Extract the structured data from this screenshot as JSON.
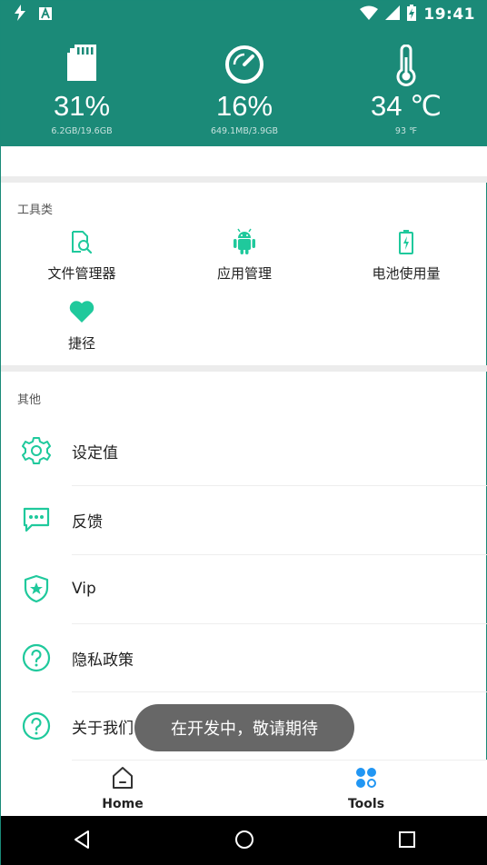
{
  "status_bar": {
    "time": "19:41",
    "left_icons": [
      "flash-icon",
      "font-a-icon"
    ],
    "right_icons": [
      "wifi-icon",
      "cell-signal-icon",
      "battery-charging-icon"
    ]
  },
  "stats": [
    {
      "icon": "sd-card-icon",
      "value": "31%",
      "sub": "6.2GB/19.6GB"
    },
    {
      "icon": "speedometer-icon",
      "value": "16%",
      "sub": "649.1MB/3.9GB"
    },
    {
      "icon": "thermometer-icon",
      "value": "34 ℃",
      "sub": "93 ℉"
    }
  ],
  "tools_section": {
    "label": "工具类",
    "items": [
      {
        "icon": "file-search-icon",
        "label": "文件管理器"
      },
      {
        "icon": "android-icon",
        "label": "应用管理"
      },
      {
        "icon": "battery-icon",
        "label": "电池使用量"
      },
      {
        "icon": "heart-icon",
        "label": "捷径"
      }
    ]
  },
  "other_section": {
    "label": "其他",
    "items": [
      {
        "icon": "gear-icon",
        "label": "设定值"
      },
      {
        "icon": "chat-bubble-icon",
        "label": "反馈"
      },
      {
        "icon": "shield-star-icon",
        "label": "Vip"
      },
      {
        "icon": "help-circle-icon",
        "label": "隐私政策"
      },
      {
        "icon": "help-circle-icon",
        "label": "关于我们"
      }
    ]
  },
  "toast": {
    "text": "在开发中，敬请期待"
  },
  "bottom_nav": [
    {
      "icon": "home-icon",
      "label": "Home"
    },
    {
      "icon": "tools-grid-icon",
      "label": "Tools"
    }
  ],
  "system_nav": [
    "back-icon",
    "home-circle-icon",
    "recents-icon"
  ],
  "colors": {
    "header": "#1b8a78",
    "accent": "#1fc99c",
    "nav_active": "#2196f3"
  }
}
